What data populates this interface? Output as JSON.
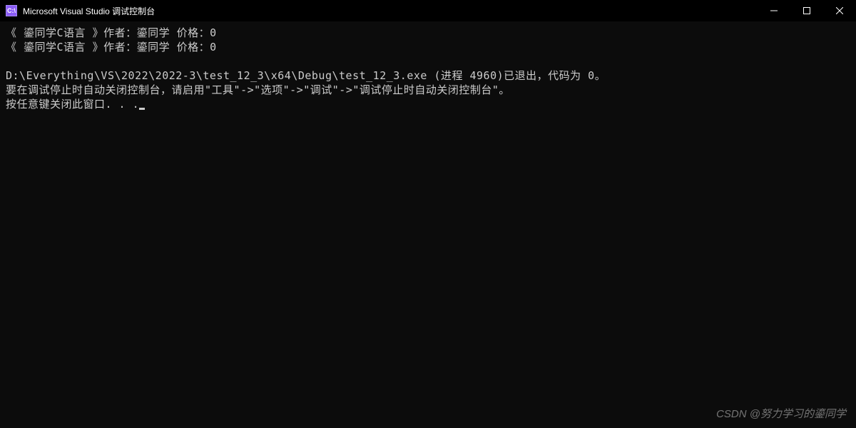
{
  "window": {
    "icon_label": "C:\\",
    "title": "Microsoft Visual Studio 调试控制台"
  },
  "console": {
    "line1": "《 鎏同学C语言 》作者：鎏同学 价格：0",
    "line2": "《 鎏同学C语言 》作者：鎏同学 价格：0",
    "blank": "",
    "line3": "D:\\Everything\\VS\\2022\\2022-3\\test_12_3\\x64\\Debug\\test_12_3.exe (进程 4960)已退出，代码为 0。",
    "line4": "要在调试停止时自动关闭控制台，请启用\"工具\"->\"选项\"->\"调试\"->\"调试停止时自动关闭控制台\"。",
    "line5": "按任意键关闭此窗口. . ."
  },
  "watermark": "CSDN @努力学习的鎏同学"
}
